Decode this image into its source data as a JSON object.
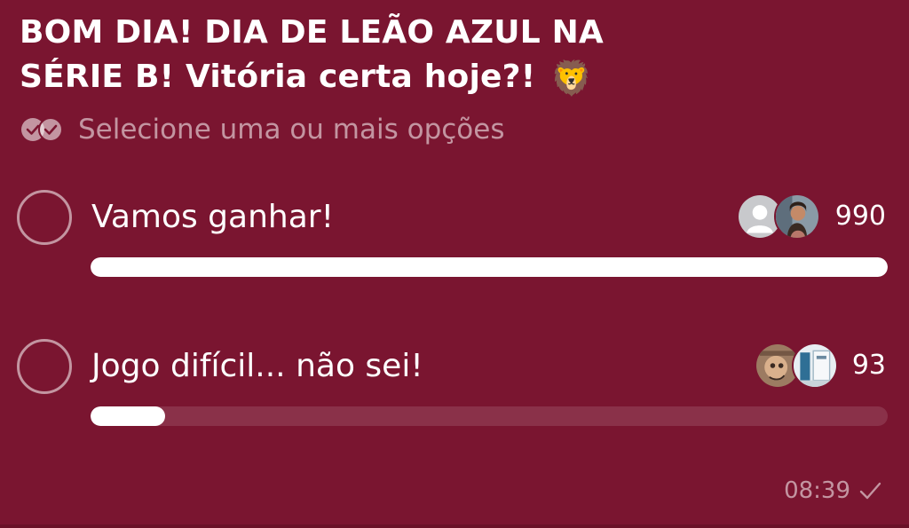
{
  "poll": {
    "question": "BOM DIA! DIA DE LEÃO AZUL NA SÉRIE B! Vitória certa hoje?!",
    "question_emoji": "🦁",
    "hint_icon": "double-check-circle-icon",
    "hint": "Selecione uma ou mais opções",
    "options": [
      {
        "label": "Vamos ganhar!",
        "count": "990",
        "fraction": 1.0,
        "avatars": [
          "default-user-avatar",
          "user-photo-avatar"
        ]
      },
      {
        "label": "Jogo difícil... não sei!",
        "count": "93",
        "fraction": 0.094,
        "avatars": [
          "user-photo-avatar",
          "user-photo-avatar"
        ]
      }
    ],
    "time": "08:39",
    "status_icon": "sent-check-icon"
  },
  "colors": {
    "background": "#7a1530",
    "bar_fill": "#ffffff",
    "muted_text": "rgba(255,255,255,0.55)"
  }
}
